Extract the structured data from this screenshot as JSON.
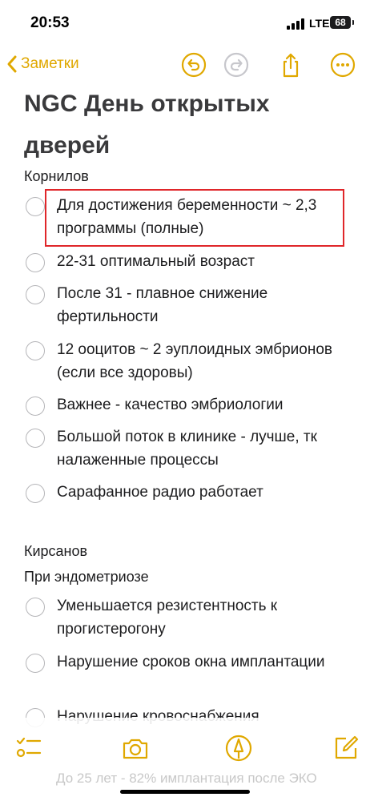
{
  "status_bar": {
    "time": "20:53",
    "network": "LTE",
    "battery": "68"
  },
  "nav": {
    "back_label": "Заметки"
  },
  "note": {
    "title": "NGC День открытых дверей",
    "sections": [
      {
        "heading": "Корнилов",
        "items": [
          {
            "text": "Для достижения беременности ~ 2,3 программы (полные)"
          },
          {
            "text": "22-31 оптимальный возраст"
          },
          {
            "text": "После 31 - плавное снижение фертильности"
          },
          {
            "text": "12 ооцитов ~ 2 эуплоидных эмбрионов (если все здоровы)"
          },
          {
            "text": "Важнее - качество эмбриологии"
          },
          {
            "text": "Большой поток в клинике - лучше, тк налаженные процессы"
          },
          {
            "text": "Сарафанное радио работает"
          }
        ]
      },
      {
        "heading": "Кирсанов",
        "subheading": "При эндометриозе",
        "items": [
          {
            "text": "Уменьшается резистентность к прогистерогону"
          },
          {
            "text": "Нарушение сроков окна имплантации"
          },
          {
            "text": "Нарушение кровоснабжения"
          }
        ]
      }
    ],
    "hidden_line": "До 25 лет - 82% имплантация после ЭКО"
  },
  "icons": {
    "back": "chevron-left-icon",
    "undo": "undo-icon",
    "redo": "redo-icon",
    "share": "share-icon",
    "more": "more-icon",
    "checklist": "checklist-icon",
    "camera": "camera-icon",
    "markup": "pen-icon",
    "compose": "compose-icon"
  },
  "colors": {
    "accent": "#e0a800",
    "highlight": "#e0262a",
    "text": "#1c1c1e"
  }
}
